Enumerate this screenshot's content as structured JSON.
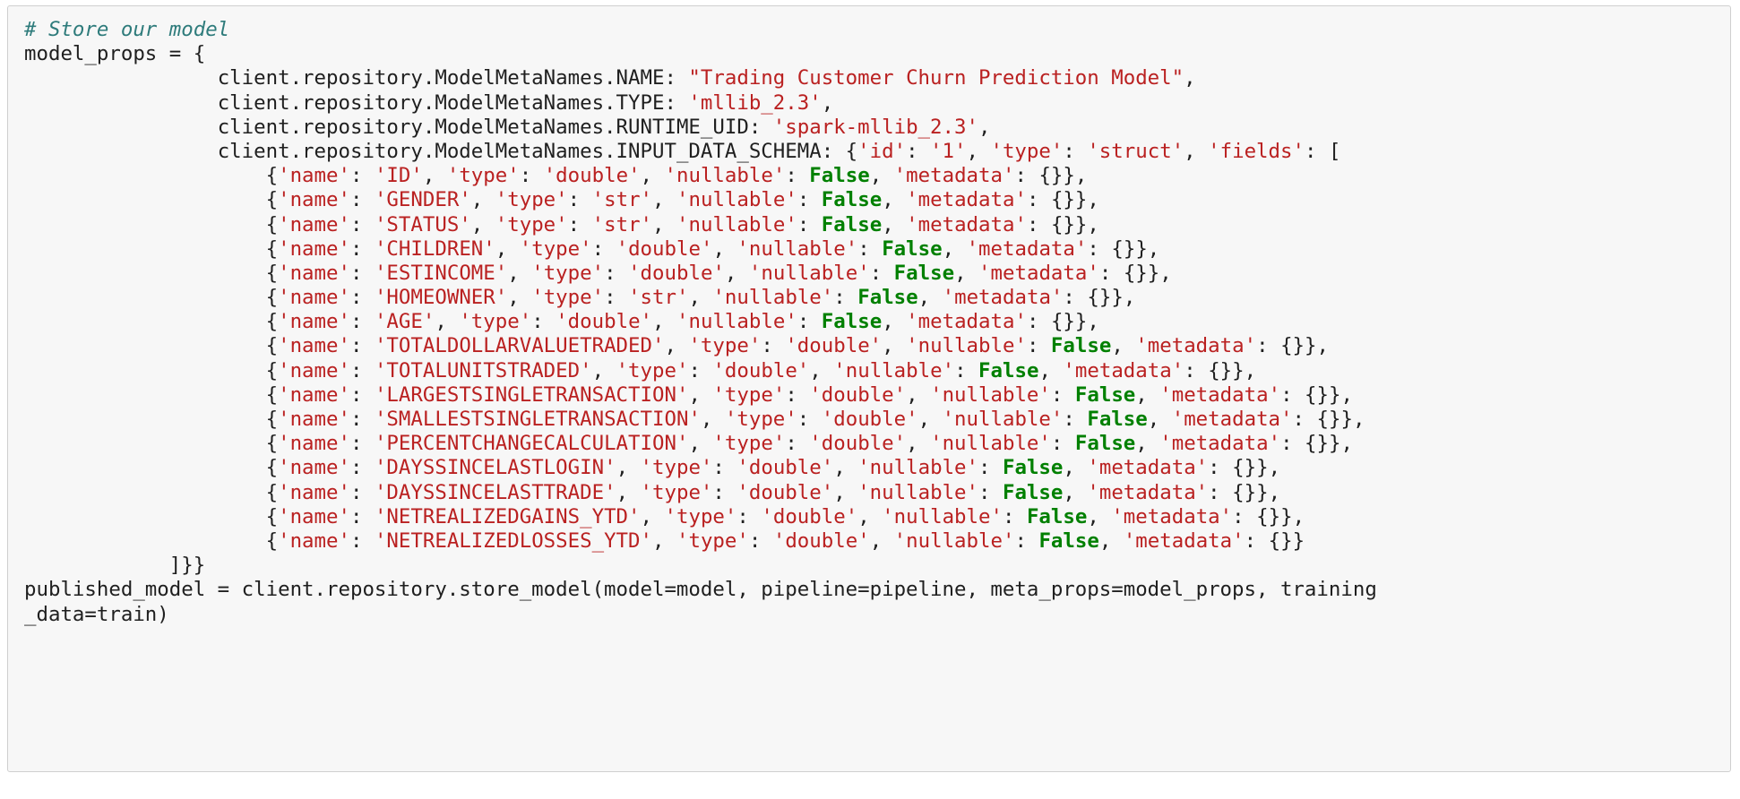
{
  "cell": {
    "kind": "code-cell",
    "language": "python",
    "background_color": "#f7f7f7",
    "border_color": "#cfcfcf",
    "colors": {
      "comment": "#2e7b7b",
      "string": "#ba2121",
      "keyword": "#008000",
      "plain": "#1f1f1f"
    },
    "comment": "# Store our model",
    "assignment_open": "model_props = {",
    "meta": {
      "indent": "                ",
      "name_key": "client.repository.ModelMetaNames.NAME: ",
      "name_value": "\"Trading Customer Churn Prediction Model\"",
      "name_trail": ",",
      "type_key": "client.repository.ModelMetaNames.TYPE: ",
      "type_value": "'mllib_2.3'",
      "type_trail": ",",
      "runtime_key": "client.repository.ModelMetaNames.RUNTIME_UID: ",
      "runtime_value": "'spark-mllib_2.3'",
      "runtime_trail": ",",
      "schema_key": "client.repository.ModelMetaNames.INPUT_DATA_SCHEMA: ",
      "schema_open_brace": "{",
      "schema_id_key": "'id'",
      "schema_colon": ": ",
      "schema_id_value": "'1'",
      "schema_sep1": ", ",
      "schema_type_key": "'type'",
      "schema_type_value": "'struct'",
      "schema_sep2": ", ",
      "schema_fields_key": "'fields'",
      "schema_fields_open": ": ["
    },
    "fields_indent": "                    ",
    "fields": [
      {
        "name": "'ID'",
        "type": "'double'",
        "nullable": "False",
        "metadata": "{}",
        "trailing_comma": ","
      },
      {
        "name": "'GENDER'",
        "type": "'str'",
        "nullable": "False",
        "metadata": "{}",
        "trailing_comma": ","
      },
      {
        "name": "'STATUS'",
        "type": "'str'",
        "nullable": "False",
        "metadata": "{}",
        "trailing_comma": ","
      },
      {
        "name": "'CHILDREN'",
        "type": "'double'",
        "nullable": "False",
        "metadata": "{}",
        "trailing_comma": ","
      },
      {
        "name": "'ESTINCOME'",
        "type": "'double'",
        "nullable": "False",
        "metadata": "{}",
        "trailing_comma": ","
      },
      {
        "name": "'HOMEOWNER'",
        "type": "'str'",
        "nullable": "False",
        "metadata": "{}",
        "trailing_comma": ","
      },
      {
        "name": "'AGE'",
        "type": "'double'",
        "nullable": "False",
        "metadata": "{}",
        "trailing_comma": ","
      },
      {
        "name": "'TOTALDOLLARVALUETRADED'",
        "type": "'double'",
        "nullable": "False",
        "metadata": "{}",
        "trailing_comma": ","
      },
      {
        "name": "'TOTALUNITSTRADED'",
        "type": "'double'",
        "nullable": "False",
        "metadata": "{}",
        "trailing_comma": ","
      },
      {
        "name": "'LARGESTSINGLETRANSACTION'",
        "type": "'double'",
        "nullable": "False",
        "metadata": "{}",
        "trailing_comma": ","
      },
      {
        "name": "'SMALLESTSINGLETRANSACTION'",
        "type": "'double'",
        "nullable": "False",
        "metadata": "{}",
        "trailing_comma": ","
      },
      {
        "name": "'PERCENTCHANGECALCULATION'",
        "type": "'double'",
        "nullable": "False",
        "metadata": "{}",
        "trailing_comma": ","
      },
      {
        "name": "'DAYSSINCELASTLOGIN'",
        "type": "'double'",
        "nullable": "False",
        "metadata": "{}",
        "trailing_comma": ","
      },
      {
        "name": "'DAYSSINCELASTTRADE'",
        "type": "'double'",
        "nullable": "False",
        "metadata": "{}",
        "trailing_comma": ","
      },
      {
        "name": "'NETREALIZEDGAINS_YTD'",
        "type": "'double'",
        "nullable": "False",
        "metadata": "{}",
        "trailing_comma": ","
      },
      {
        "name": "'NETREALIZEDLOSSES_YTD'",
        "type": "'double'",
        "nullable": "False",
        "metadata": "{}",
        "trailing_comma": ""
      }
    ],
    "field_tokens": {
      "open": "{",
      "name_key": "'name'",
      "colon": ": ",
      "comma": ", ",
      "type_key": "'type'",
      "nullable_key": "'nullable'",
      "metadata_key": "'metadata'",
      "close": "}"
    },
    "close_line_indent": "            ",
    "close_line": "]}}",
    "store_call_line1": "published_model = client.repository.store_model(model=model, pipeline=pipeline, meta_props=model_props, training",
    "store_call_line2": "_data=train)"
  }
}
